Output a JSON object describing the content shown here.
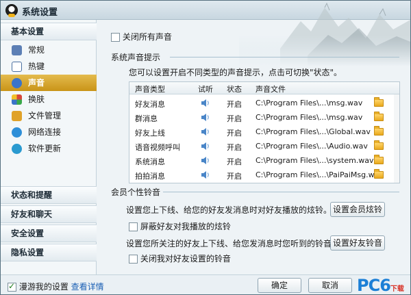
{
  "window": {
    "title": "系统设置"
  },
  "sidebar": {
    "groups": [
      {
        "label": "基本设置"
      },
      {
        "label": "状态和提醒"
      },
      {
        "label": "好友和聊天"
      },
      {
        "label": "安全设置"
      },
      {
        "label": "隐私设置"
      }
    ],
    "items": [
      {
        "label": "常规",
        "icon": "general-icon",
        "color": "#5c7fb5"
      },
      {
        "label": "热键",
        "icon": "hotkey-icon",
        "color": "#4a6fa0"
      },
      {
        "label": "声音",
        "icon": "sound-icon",
        "color": "#3a74c9",
        "active": true
      },
      {
        "label": "换肤",
        "icon": "skin-icon",
        "color": "#d7463a"
      },
      {
        "label": "文件管理",
        "icon": "file-manage-icon",
        "color": "#e0a229"
      },
      {
        "label": "网络连接",
        "icon": "network-icon",
        "color": "#2e8fd8"
      },
      {
        "label": "软件更新",
        "icon": "update-icon",
        "color": "#2a9ad0"
      }
    ]
  },
  "sound": {
    "mute_all_label": "关闭所有声音",
    "mute_all_checked": false,
    "section_title": "系统声音提示",
    "description": "您可以设置开启不同类型的声音提示，点击可切换\"状态\"。",
    "table": {
      "headers": [
        "声音类型",
        "试听",
        "状态",
        "声音文件"
      ],
      "rows": [
        {
          "type": "好友消息",
          "status": "开启",
          "file": "C:\\Program Files\\...\\msg.wav"
        },
        {
          "type": "群消息",
          "status": "开启",
          "file": "C:\\Program Files\\...\\msg.wav"
        },
        {
          "type": "好友上线",
          "status": "开启",
          "file": "C:\\Program Files\\...\\Global.wav"
        },
        {
          "type": "语音视频呼叫",
          "status": "开启",
          "file": "C:\\Program Files\\...\\Audio.wav"
        },
        {
          "type": "系统消息",
          "status": "开启",
          "file": "C:\\Program Files\\...\\system.wav"
        },
        {
          "type": "拍拍消息",
          "status": "开启",
          "file": "C:\\Program Files\\...\\PaiPaiMsg.wav"
        }
      ]
    }
  },
  "ringtone": {
    "section_title": "会员个性铃音",
    "member_desc": "设置您上下线、给您的好友发消息时对好友播放的炫铃。",
    "member_button": "设置会员炫铃",
    "block_label": "屏蔽好友对我播放的炫铃",
    "block_checked": false,
    "friend_desc": "设置您所关注的好友上下线、给您发消息时您听到的铃音。",
    "friend_button": "设置好友铃音",
    "close_label": "关闭我对好友设置的铃音",
    "close_checked": false
  },
  "footer": {
    "roam_label": "漫游我的设置",
    "roam_checked": true,
    "details_link": "查看详情",
    "ok_button": "确定",
    "cancel_button": "取消"
  },
  "watermark": {
    "text": "PC6",
    "sub": "下载"
  }
}
